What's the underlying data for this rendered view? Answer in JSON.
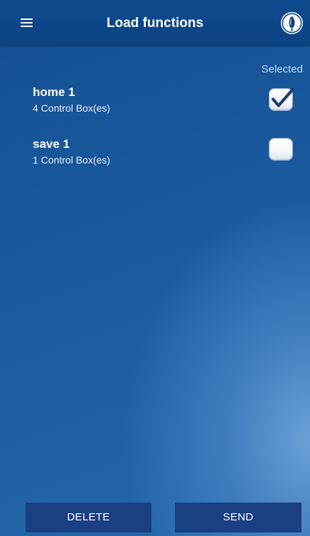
{
  "header": {
    "title": "Load functions",
    "menu_icon": "hamburger-menu-icon",
    "right_icon": "lightbulb-icon"
  },
  "list": {
    "column_header": "Selected",
    "items": [
      {
        "name": "home 1",
        "detail": "4 Control Box(es)",
        "selected": true
      },
      {
        "name": "save 1",
        "detail": "1 Control Box(es)",
        "selected": false
      }
    ]
  },
  "actions": {
    "delete_label": "DELETE",
    "send_label": "SEND"
  },
  "colors": {
    "topbar": "#0b4282",
    "background": "#1a5a9f",
    "button": "#1a3f83",
    "checkmark": "#1f3f73"
  }
}
